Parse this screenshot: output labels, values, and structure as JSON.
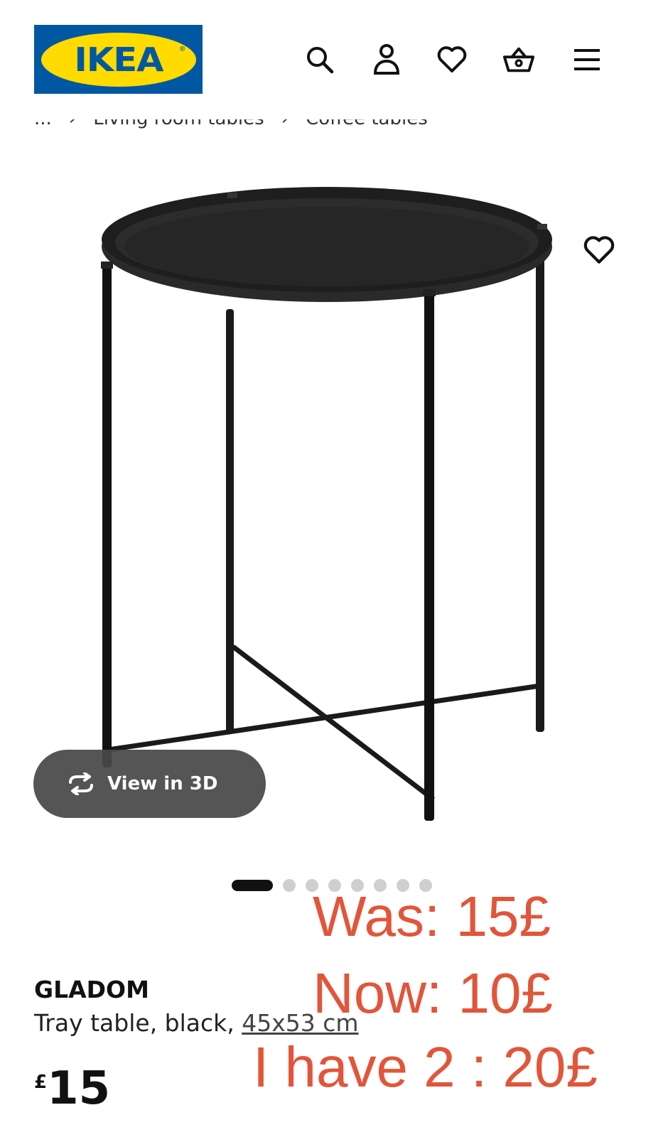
{
  "header": {
    "logo_text": "IKEA",
    "icons": [
      "search-icon",
      "profile-icon",
      "wishlist-icon",
      "basket-icon",
      "menu-icon"
    ]
  },
  "breadcrumb": {
    "ellipsis": "...",
    "items": [
      "Living room tables",
      "Coffee tables"
    ]
  },
  "gallery": {
    "view_3d_label": "View in 3D",
    "image_count": 8,
    "active_index": 1
  },
  "product": {
    "name": "GLADOM",
    "description": "Tray table, black,",
    "dimensions": "45x53 cm",
    "price_currency": "£",
    "price_value": "15"
  },
  "annotation": {
    "was": "Was: 15£",
    "now": "Now: 10£",
    "have": "I have 2 : 20£",
    "color": "#e2553a"
  },
  "colors": {
    "ikea_blue": "#0058a3",
    "ikea_yellow": "#ffdb00"
  }
}
